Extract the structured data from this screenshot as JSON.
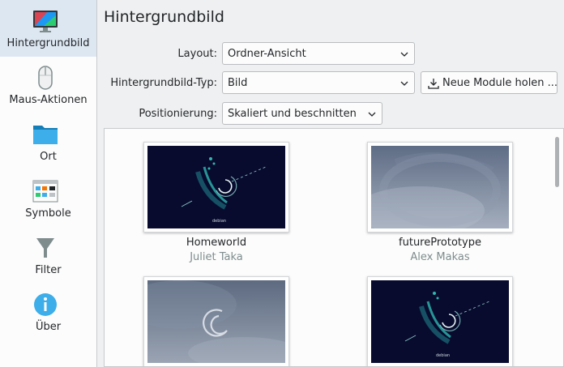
{
  "sidebar": {
    "items": [
      {
        "label": "Hintergrundbild",
        "icon": "monitor-icon"
      },
      {
        "label": "Maus-Aktionen",
        "icon": "mouse-icon"
      },
      {
        "label": "Ort",
        "icon": "folder-icon"
      },
      {
        "label": "Symbole",
        "icon": "symbols-icon"
      },
      {
        "label": "Filter",
        "icon": "filter-icon"
      },
      {
        "label": "Über",
        "icon": "info-icon"
      }
    ],
    "active_index": 0
  },
  "header": {
    "title": "Hintergrundbild"
  },
  "form": {
    "layout_label": "Layout:",
    "layout_value": "Ordner-Ansicht",
    "type_label": "Hintergrundbild-Typ:",
    "type_value": "Bild",
    "get_new_label": "Neue Module holen ...",
    "position_label": "Positionierung:",
    "position_value": "Skaliert und beschnitten"
  },
  "wallpapers": [
    {
      "name": "Homeworld",
      "author": "Juliet Taka",
      "style": "homeworld"
    },
    {
      "name": "futurePrototype",
      "author": "Alex Makas",
      "style": "future"
    },
    {
      "name": "",
      "author": "",
      "style": "debian-swirl"
    },
    {
      "name": "",
      "author": "",
      "style": "homeworld"
    }
  ],
  "colors": {
    "accent": "#dde7f1",
    "homeworld_bg": "#080b2e",
    "future_bg": "#7a879c",
    "info_blue": "#3daee9"
  }
}
